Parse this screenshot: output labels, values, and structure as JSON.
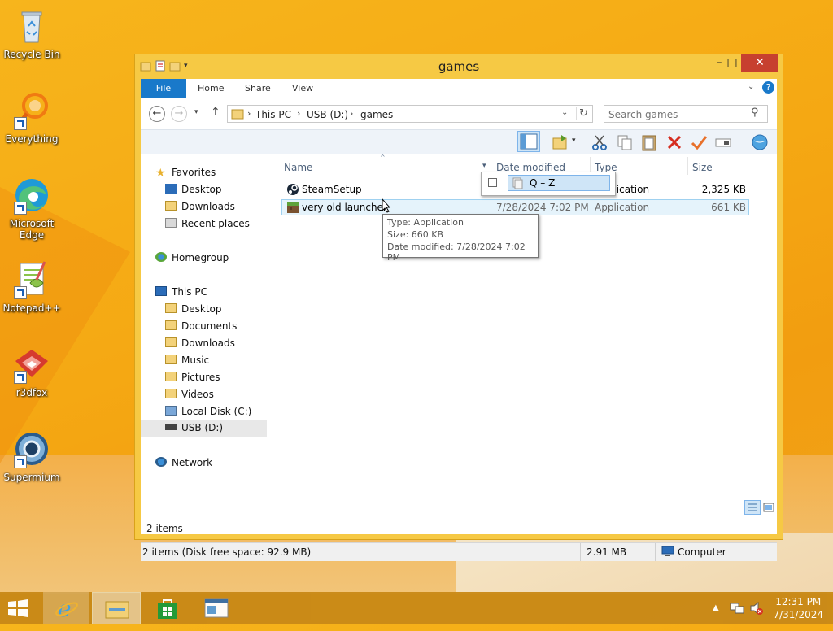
{
  "desktop": {
    "icons": [
      {
        "label": "Recycle Bin",
        "icon": "recycle-bin-icon"
      },
      {
        "label": "Everything",
        "icon": "everything-search-icon"
      },
      {
        "label": "Microsoft Edge",
        "icon": "edge-browser-icon"
      },
      {
        "label": "Notepad++",
        "icon": "notepad-plus-plus-icon"
      },
      {
        "label": "r3dfox",
        "icon": "r3dfox-browser-icon"
      },
      {
        "label": "Supermium",
        "icon": "supermium-browser-icon"
      }
    ]
  },
  "window": {
    "title": "games",
    "ribbon_tabs": [
      "File",
      "Home",
      "Share",
      "View"
    ],
    "address": {
      "crumbs": [
        "This PC",
        "USB (D:)",
        "games"
      ]
    },
    "search": {
      "placeholder": "Search games"
    },
    "nav": {
      "favorites": "Favorites",
      "favorites_items": [
        "Desktop",
        "Downloads",
        "Recent places"
      ],
      "homegroup": "Homegroup",
      "this_pc": "This PC",
      "this_pc_items": [
        "Desktop",
        "Documents",
        "Downloads",
        "Music",
        "Pictures",
        "Videos",
        "Local Disk (C:)",
        "USB (D:)"
      ],
      "network": "Network"
    },
    "columns": {
      "name": "Name",
      "date": "Date modified",
      "type": "Type",
      "size": "Size"
    },
    "files": [
      {
        "name": "SteamSetup",
        "date": "",
        "type": "Application",
        "size": "2,325 KB",
        "icon": "steam-icon"
      },
      {
        "name": "very old launcher",
        "date": "7/28/2024 7:02 PM",
        "type": "Application",
        "size": "661 KB",
        "icon": "minecraft-launcher-icon"
      }
    ],
    "filter_popup": {
      "label": "Q – Z"
    },
    "tooltip": {
      "type": "Type: Application",
      "size": "Size: 660 KB",
      "date": "Date modified: 7/28/2024 7:02 PM"
    },
    "item_count": "2 items",
    "status": {
      "left": "2 items (Disk free space: 92.9 MB)",
      "size": "2.91 MB",
      "location": "Computer"
    }
  },
  "taskbar": {
    "time": "12:31 PM",
    "date": "7/31/2024"
  },
  "colors": {
    "accent": "#1979ca",
    "window_frame": "#f6c944",
    "taskbar": "#c98a18"
  }
}
